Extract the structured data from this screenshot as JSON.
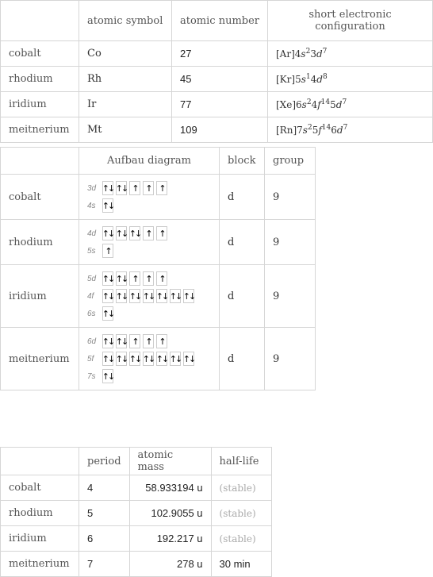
{
  "table1": {
    "headers": [
      "",
      "atomic symbol",
      "atomic number",
      "short electronic configuration"
    ],
    "rows": [
      {
        "name": "cobalt",
        "symbol": "Co",
        "number": "27",
        "config": {
          "core": "[Ar]",
          "parts": [
            [
              "4",
              "s",
              "2"
            ],
            [
              "3",
              "d",
              "7"
            ]
          ]
        }
      },
      {
        "name": "rhodium",
        "symbol": "Rh",
        "number": "45",
        "config": {
          "core": "[Kr]",
          "parts": [
            [
              "5",
              "s",
              "1"
            ],
            [
              "4",
              "d",
              "8"
            ]
          ]
        }
      },
      {
        "name": "iridium",
        "symbol": "Ir",
        "number": "77",
        "config": {
          "core": "[Xe]",
          "parts": [
            [
              "6",
              "s",
              "2"
            ],
            [
              "4",
              "f",
              "14"
            ],
            [
              "5",
              "d",
              "7"
            ]
          ]
        }
      },
      {
        "name": "meitnerium",
        "symbol": "Mt",
        "number": "109",
        "config": {
          "core": "[Rn]",
          "parts": [
            [
              "7",
              "s",
              "2"
            ],
            [
              "5",
              "f",
              "14"
            ],
            [
              "6",
              "d",
              "7"
            ]
          ]
        }
      }
    ]
  },
  "table2": {
    "headers": [
      "",
      "Aufbau diagram",
      "block",
      "group"
    ],
    "rows": [
      {
        "name": "cobalt",
        "block": "d",
        "group": "9",
        "orbitals": [
          {
            "label": "3d",
            "boxes": [
              "↑↓",
              "↑↓",
              "↑",
              "↑",
              "↑"
            ]
          },
          {
            "label": "4s",
            "boxes": [
              "↑↓"
            ]
          }
        ]
      },
      {
        "name": "rhodium",
        "block": "d",
        "group": "9",
        "orbitals": [
          {
            "label": "4d",
            "boxes": [
              "↑↓",
              "↑↓",
              "↑↓",
              "↑",
              "↑"
            ]
          },
          {
            "label": "5s",
            "boxes": [
              "↑"
            ]
          }
        ]
      },
      {
        "name": "iridium",
        "block": "d",
        "group": "9",
        "orbitals": [
          {
            "label": "5d",
            "boxes": [
              "↑↓",
              "↑↓",
              "↑",
              "↑",
              "↑"
            ]
          },
          {
            "label": "4f",
            "boxes": [
              "↑↓",
              "↑↓",
              "↑↓",
              "↑↓",
              "↑↓",
              "↑↓",
              "↑↓"
            ]
          },
          {
            "label": "6s",
            "boxes": [
              "↑↓"
            ]
          }
        ]
      },
      {
        "name": "meitnerium",
        "block": "d",
        "group": "9",
        "orbitals": [
          {
            "label": "6d",
            "boxes": [
              "↑↓",
              "↑↓",
              "↑",
              "↑",
              "↑"
            ]
          },
          {
            "label": "5f",
            "boxes": [
              "↑↓",
              "↑↓",
              "↑↓",
              "↑↓",
              "↑↓",
              "↑↓",
              "↑↓"
            ]
          },
          {
            "label": "7s",
            "boxes": [
              "↑↓"
            ]
          }
        ]
      }
    ]
  },
  "table3": {
    "headers": [
      "",
      "period",
      "atomic mass",
      "half-life"
    ],
    "rows": [
      {
        "name": "cobalt",
        "period": "4",
        "mass": "58.933194 u",
        "halflife": "(stable)",
        "stable": true
      },
      {
        "name": "rhodium",
        "period": "5",
        "mass": "102.9055 u",
        "halflife": "(stable)",
        "stable": true
      },
      {
        "name": "iridium",
        "period": "6",
        "mass": "192.217 u",
        "halflife": "(stable)",
        "stable": true
      },
      {
        "name": "meitnerium",
        "period": "7",
        "mass": "278 u",
        "halflife": "30 min",
        "stable": false
      }
    ]
  }
}
